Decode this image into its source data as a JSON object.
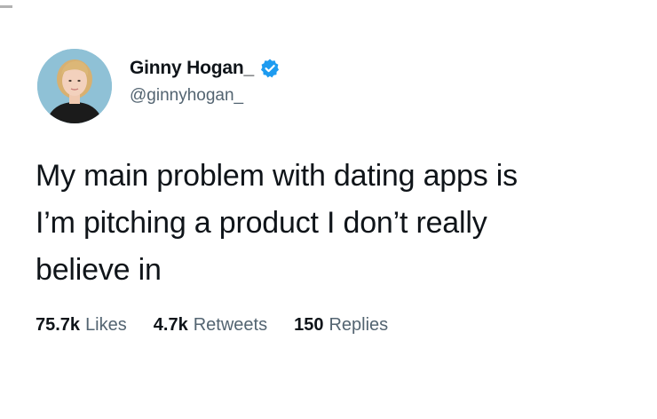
{
  "tweet": {
    "author": {
      "display_name": "Ginny Hogan_",
      "handle": "@ginnyhogan_",
      "avatar": "avatar-photo-woman-blonde",
      "verified_icon": "verified-badge-icon",
      "verified_color": "#1d9bf0"
    },
    "text": "My main problem with dating apps is\nI’m pitching a product I don’t really\nbelieve in",
    "stats": [
      {
        "count": "75.7k",
        "label": "Likes"
      },
      {
        "count": "4.7k",
        "label": "Retweets"
      },
      {
        "count": "150",
        "label": "Replies"
      }
    ]
  },
  "colors": {
    "text_primary": "#0f1419",
    "text_secondary": "#536471",
    "background": "#ffffff",
    "avatar_background": "#8fc1d6"
  }
}
